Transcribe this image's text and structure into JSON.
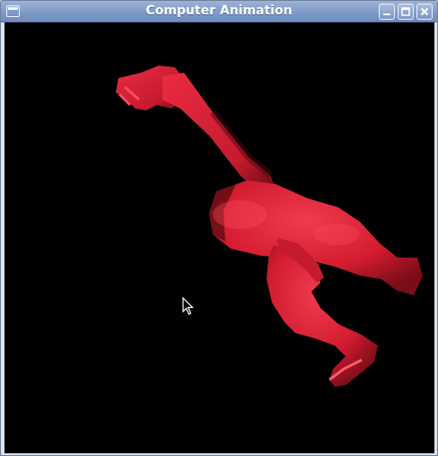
{
  "window": {
    "title": "Computer Animation",
    "controls": [
      "minimize",
      "maximize",
      "close"
    ]
  },
  "viewport": {
    "background": "#000000",
    "model_color": "#e01f35",
    "icons": [
      "window-menu-icon",
      "minimize-icon",
      "maximize-icon",
      "close-icon",
      "mouse-cursor-icon"
    ]
  }
}
